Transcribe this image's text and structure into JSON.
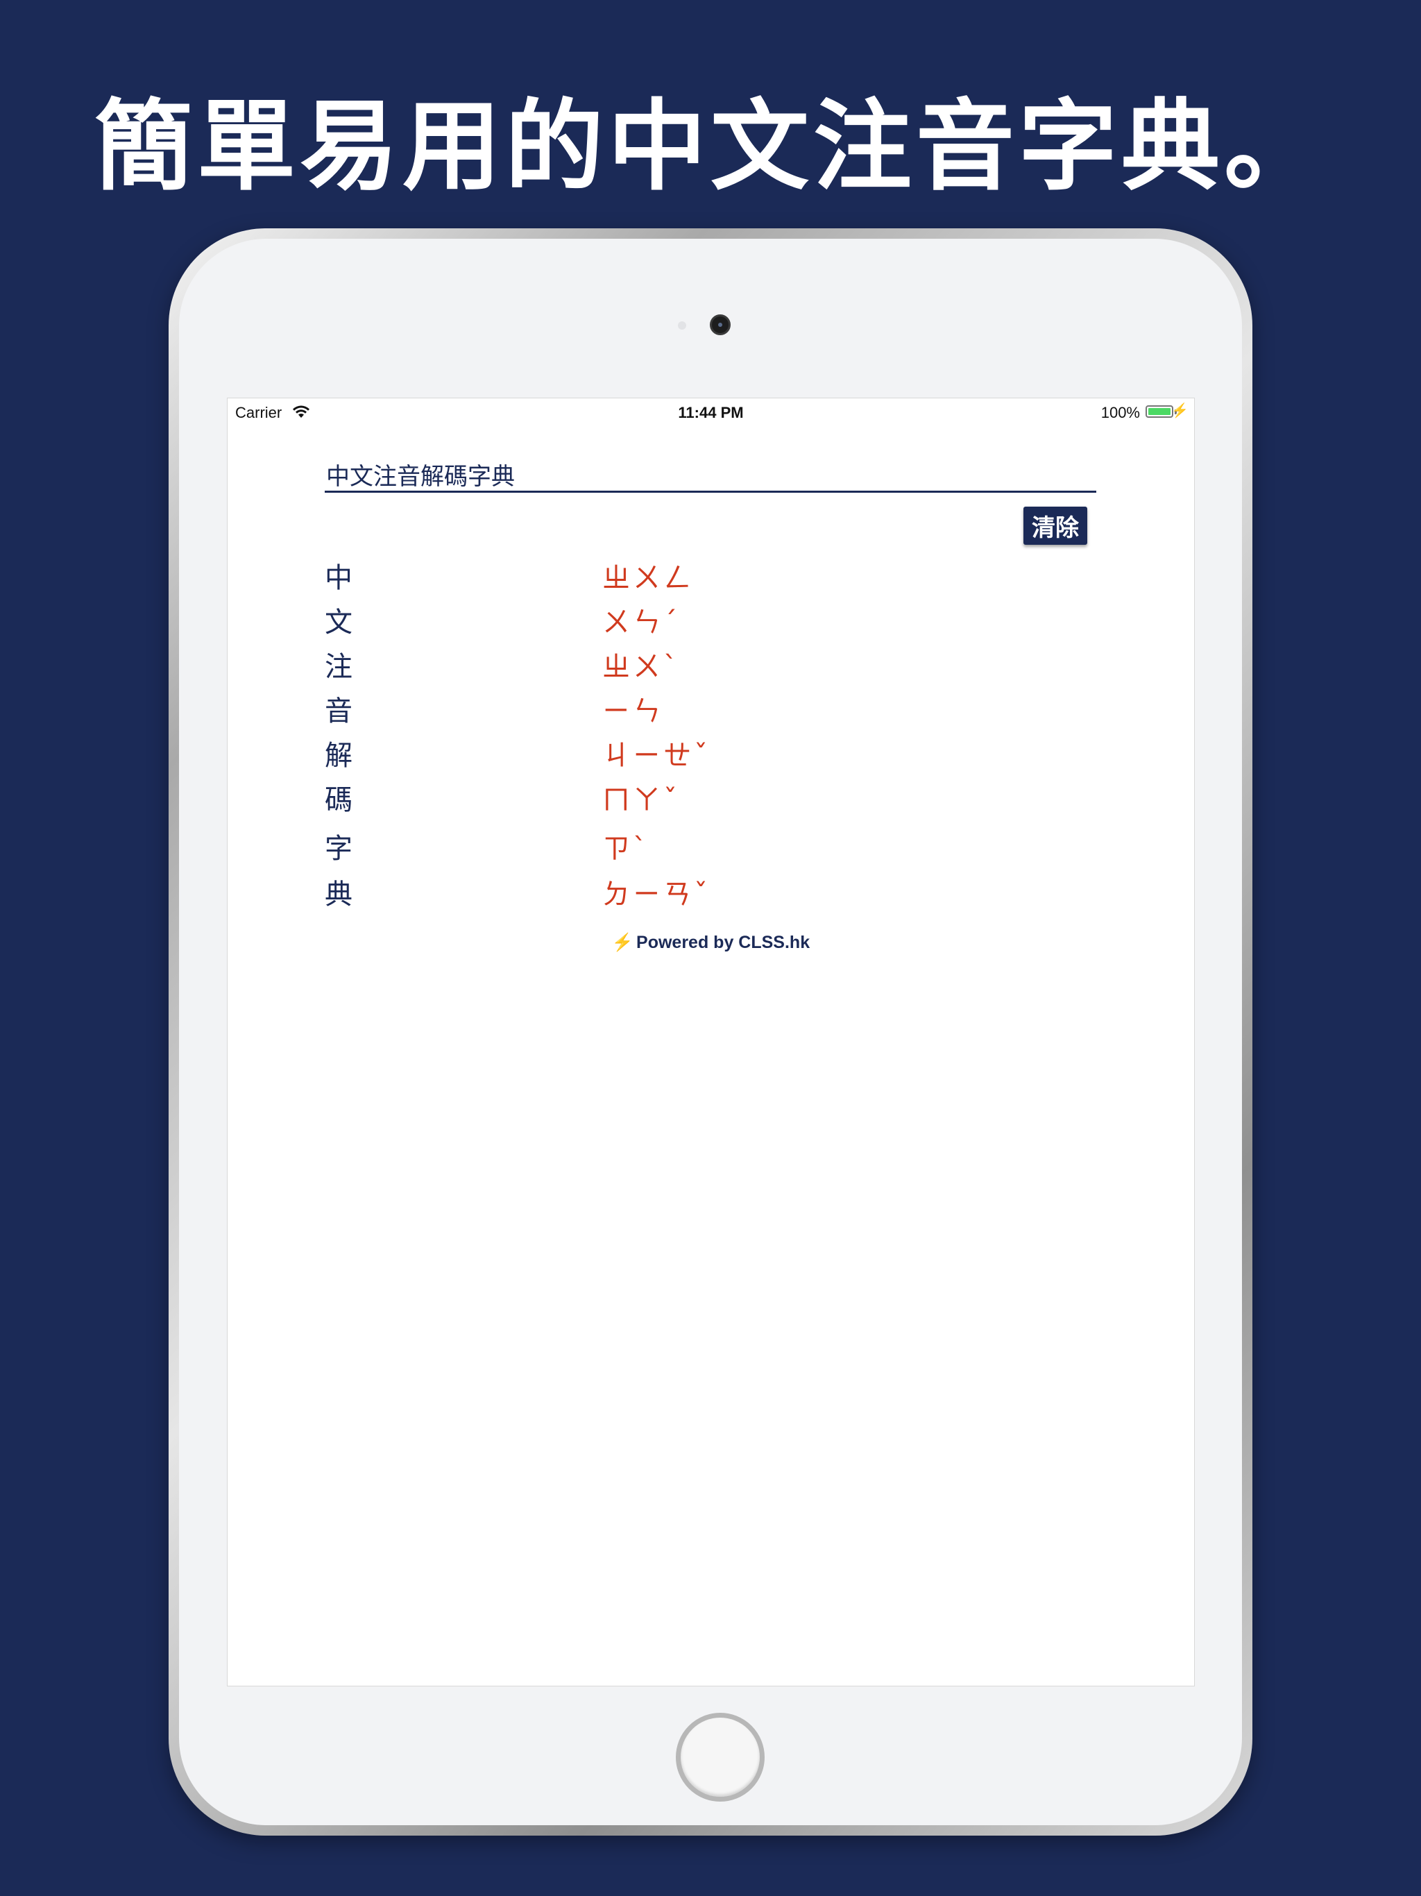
{
  "headline": "簡單易用的中文注音字典。",
  "status_bar": {
    "carrier": "Carrier",
    "time": "11:44 PM",
    "battery_percent": "100%",
    "wifi_icon": "wifi-icon",
    "battery_icon": "battery-icon",
    "charging_icon": "charging-bolt-icon",
    "battery_level": 1.0
  },
  "search": {
    "value": "中文注音解碼字典",
    "placeholder": ""
  },
  "clear_button_label": "清除",
  "entries": [
    {
      "char": "中",
      "zhuyin": "ㄓㄨㄥ"
    },
    {
      "char": "文",
      "zhuyin": "ㄨㄣˊ"
    },
    {
      "char": "注",
      "zhuyin": "ㄓㄨˋ"
    },
    {
      "char": "音",
      "zhuyin": "ㄧㄣ"
    },
    {
      "char": "解",
      "zhuyin": "ㄐㄧㄝˇ"
    },
    {
      "char": "碼",
      "zhuyin": "ㄇㄚˇ"
    },
    {
      "char": "字",
      "zhuyin": "ㄗˋ"
    },
    {
      "char": "典",
      "zhuyin": "ㄉㄧㄢˇ"
    }
  ],
  "footer": {
    "icon": "lightning-bolt-icon",
    "text": "Powered by CLSS.hk"
  },
  "colors": {
    "background": "#1b2a57",
    "accent": "#1b2a57",
    "zhuyin": "#d03a1e",
    "battery": "#4cd964"
  }
}
